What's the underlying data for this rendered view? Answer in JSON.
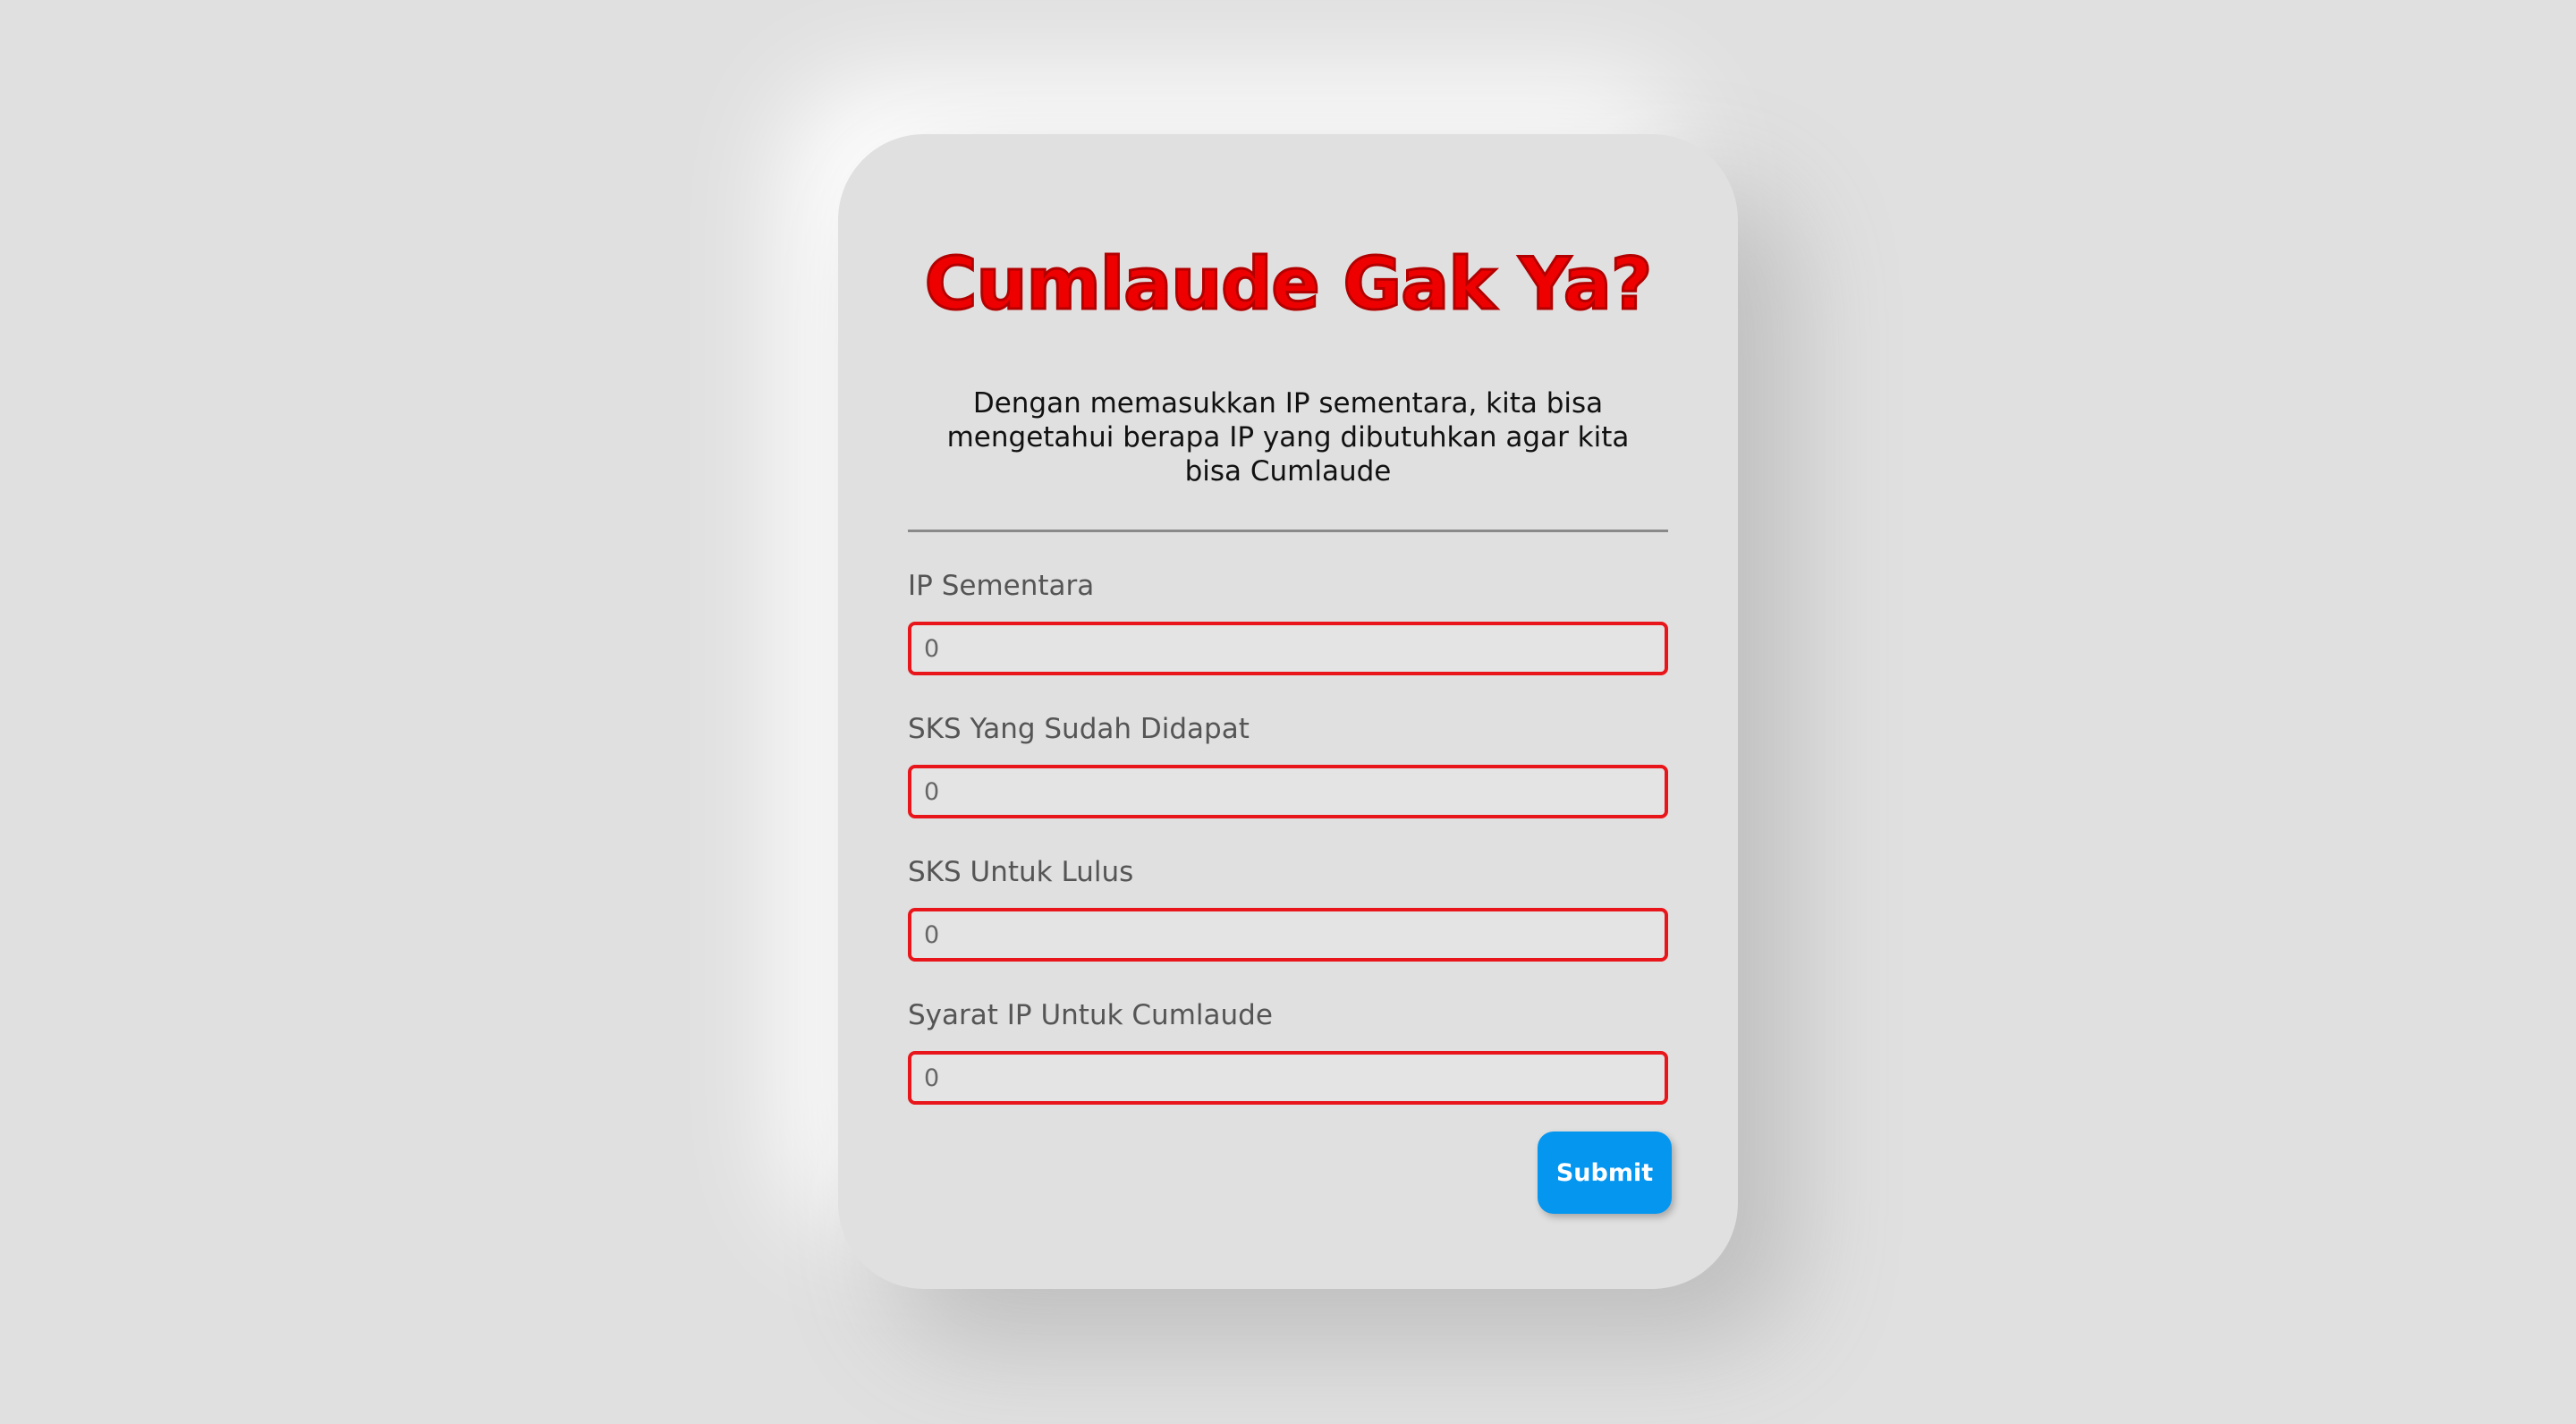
{
  "card": {
    "title": "Cumlaude Gak Ya?",
    "description": "Dengan memasukkan IP sementara, kita bisa mengetahui berapa IP yang dibutuhkan agar kita bisa Cumlaude"
  },
  "form": {
    "fields": [
      {
        "label": "IP Sementara",
        "placeholder": "0"
      },
      {
        "label": "SKS Yang Sudah Didapat",
        "placeholder": "0"
      },
      {
        "label": "SKS Untuk Lulus",
        "placeholder": "0"
      },
      {
        "label": "Syarat IP Untuk Cumlaude",
        "placeholder": "0"
      }
    ],
    "submit_label": "Submit"
  },
  "colors": {
    "background": "#e0e0e0",
    "title": "#ee0000",
    "input_border": "#e8161b",
    "submit_button": "#0596f0"
  }
}
